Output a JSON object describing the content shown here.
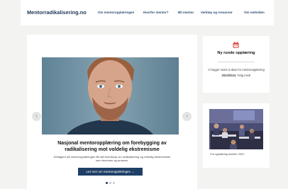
{
  "brand": "Mentorradikalisering.no",
  "nav": [
    "Om mentoropplæringen",
    "Hvorfor mentor?",
    "Bli mentor",
    "Verktøy og ressurser",
    "Om nettsiden"
  ],
  "slider": {
    "title": "Nasjonal mentoropplæring om forebygging av radikalisering mot voldelig ekstremisme",
    "text": "Deltagere på mentoropplæringen får økt kunnskap om radikalisering og voldelig ekstremisme som fenomen og prosess.",
    "cta": "Les mer om mentoropplæringen →",
    "prev": "‹",
    "next": "›",
    "slides": 3,
    "active_slide": 1
  },
  "sidebar": {
    "card1": {
      "icon": "calendar-icon",
      "title": "Ny runde opplæring",
      "text_prefix": "Vi legger snart ut dato for mentoropplæring ",
      "text_bold": "2023/2024",
      "text_suffix": ". Følg med!"
    },
    "card2": {
      "caption": "Fra opplæring høsten 2022."
    }
  },
  "colors": {
    "brand": "#243b5a",
    "nav": "#2b4a72",
    "button": "#1f3f67",
    "icon": "#d9352d",
    "background": "#f3f3f1"
  }
}
